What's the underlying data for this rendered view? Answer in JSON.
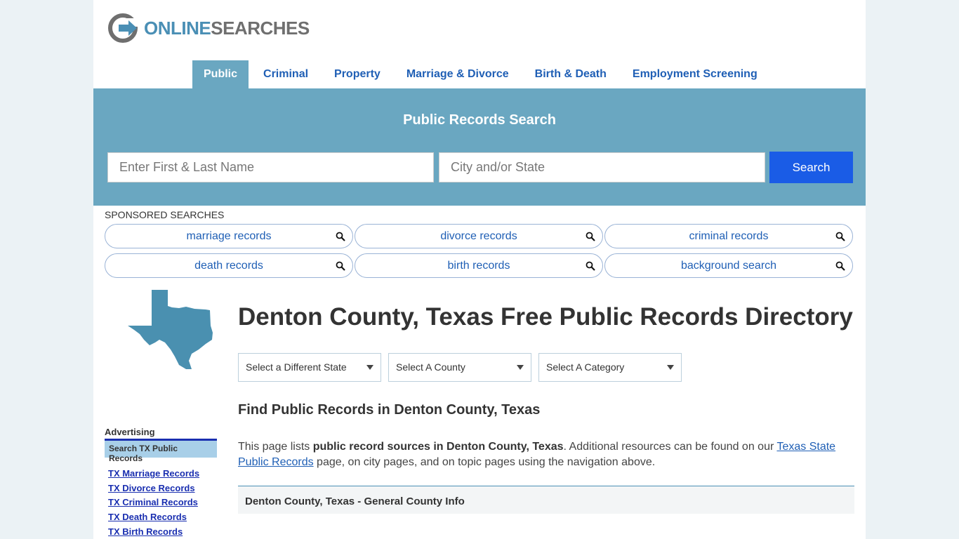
{
  "logo": {
    "part1": "ONLINE",
    "part2": "SEARCHES"
  },
  "nav": [
    {
      "label": "Public",
      "active": true
    },
    {
      "label": "Criminal"
    },
    {
      "label": "Property"
    },
    {
      "label": "Marriage & Divorce"
    },
    {
      "label": "Birth & Death"
    },
    {
      "label": "Employment Screening"
    }
  ],
  "hero": {
    "title": "Public Records Search",
    "name_placeholder": "Enter First & Last Name",
    "city_placeholder": "City and/or State",
    "button_label": "Search"
  },
  "sponsored": {
    "label": "SPONSORED SEARCHES",
    "items": [
      "marriage records",
      "divorce records",
      "criminal records",
      "death records",
      "birth records",
      "background search"
    ]
  },
  "page": {
    "title": "Denton County, Texas Free Public Records Directory",
    "selects": [
      "Select a Different State",
      "Select A County",
      "Select A Category"
    ],
    "subtitle": "Find Public Records in Denton County, Texas",
    "intro": {
      "t1": "This page lists ",
      "bold": "public record sources in Denton County, Texas",
      "t2": ". Additional resources can be found on our ",
      "link": "Texas State Public Records",
      "t3": " page, on city pages, and on topic pages using the navigation above."
    },
    "info_box": "Denton County, Texas - General County Info"
  },
  "sidebar": {
    "label": "Advertising",
    "heading": "Search TX Public Records",
    "links": [
      "TX Marriage Records",
      "TX Divorce Records",
      "TX Criminal Records",
      "TX Death Records",
      "TX Birth Records"
    ]
  },
  "colors": {
    "accent": "#6aa7c1",
    "button": "#1a5ce6",
    "link": "#1f5fb5",
    "map": "#4a90b0"
  }
}
